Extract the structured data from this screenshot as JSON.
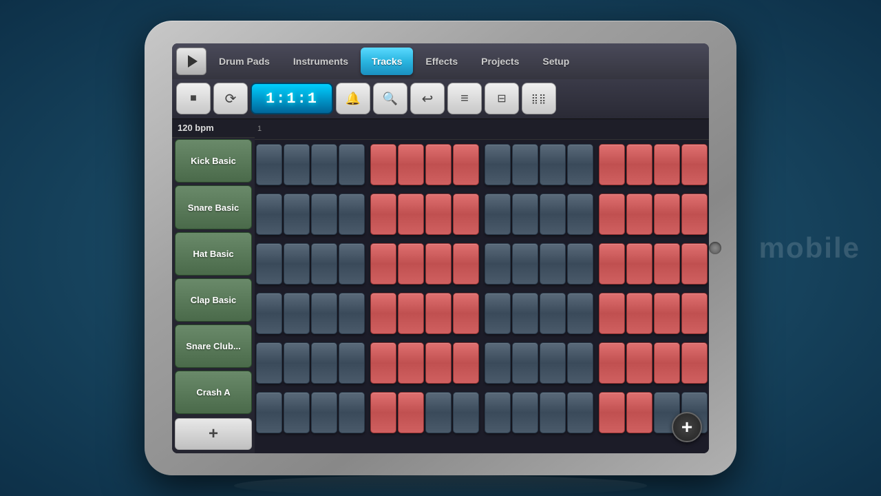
{
  "nav": {
    "play_label": "▶",
    "tabs": [
      {
        "id": "drum-pads",
        "label": "Drum Pads",
        "active": false
      },
      {
        "id": "instruments",
        "label": "Instruments",
        "active": false
      },
      {
        "id": "tracks",
        "label": "Tracks",
        "active": true
      },
      {
        "id": "effects",
        "label": "Effects",
        "active": false
      },
      {
        "id": "projects",
        "label": "Projects",
        "active": false
      },
      {
        "id": "setup",
        "label": "Setup",
        "active": false
      }
    ]
  },
  "toolbar": {
    "stop_icon": "■",
    "loop_icon": "⟳",
    "display_text": "1:1:1",
    "metronome_icon": "🔔",
    "search_icon": "🔍",
    "undo_icon": "↩",
    "list_icon": "≡",
    "grid_icon": "⊞",
    "dots_icon": "⣿"
  },
  "bpm": "120 bpm",
  "add_track_label": "+",
  "add_sequence_label": "+",
  "tracks": [
    {
      "id": "kick-basic",
      "label": "Kick Basic",
      "pattern": [
        0,
        0,
        0,
        0,
        1,
        1,
        1,
        1,
        0,
        0,
        0,
        0,
        1,
        1,
        1,
        1
      ]
    },
    {
      "id": "snare-basic",
      "label": "Snare Basic",
      "pattern": [
        0,
        0,
        0,
        0,
        1,
        1,
        1,
        1,
        0,
        0,
        0,
        0,
        1,
        1,
        1,
        1
      ]
    },
    {
      "id": "hat-basic",
      "label": "Hat Basic",
      "pattern": [
        0,
        0,
        0,
        0,
        1,
        1,
        1,
        1,
        0,
        0,
        0,
        0,
        1,
        1,
        1,
        1
      ]
    },
    {
      "id": "clap-basic",
      "label": "Clap Basic",
      "pattern": [
        0,
        0,
        0,
        0,
        1,
        1,
        1,
        1,
        0,
        0,
        0,
        0,
        1,
        1,
        1,
        1
      ]
    },
    {
      "id": "snare-club",
      "label": "Snare Club...",
      "pattern": [
        0,
        0,
        0,
        0,
        1,
        1,
        1,
        1,
        0,
        0,
        0,
        0,
        1,
        1,
        1,
        1
      ]
    },
    {
      "id": "crash-a",
      "label": "Crash A",
      "pattern": [
        0,
        0,
        0,
        0,
        1,
        1,
        1,
        1,
        0,
        0,
        0,
        0,
        1,
        1,
        1,
        1
      ]
    }
  ],
  "watermark": "mobile"
}
